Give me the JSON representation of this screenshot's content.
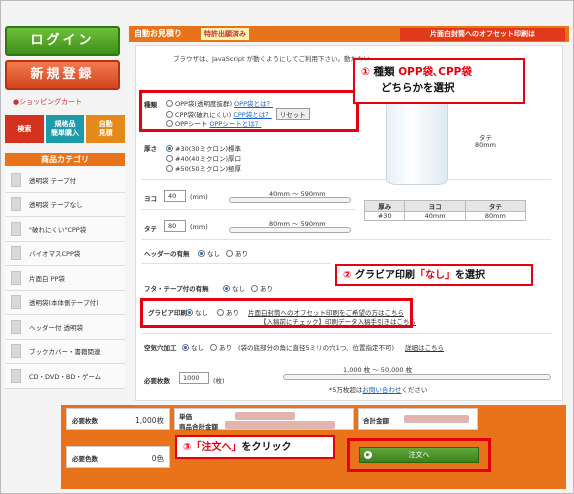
{
  "sidebar": {
    "login": "ログイン",
    "register": "新規登録",
    "cart": "ショッピングカート",
    "quick": [
      {
        "label": "検索"
      },
      {
        "label": "規格品\n簡単購入"
      },
      {
        "label": "自動\n見積"
      }
    ],
    "category_title": "商品カテゴリ",
    "categories": [
      {
        "label": "透明袋 テープ付"
      },
      {
        "label": "透明袋 テープなし"
      },
      {
        "label": "\"破れにくい\"CPP袋"
      },
      {
        "label": "バイオマスCPP袋"
      },
      {
        "label": "片面白 PP袋"
      },
      {
        "label": "透明袋(本体側テープ付)"
      },
      {
        "label": "ヘッダー付 透明袋"
      },
      {
        "label": "ブックカバー・書籍関連"
      },
      {
        "label": "CD・DVD・BD・ゲーム"
      }
    ]
  },
  "header": {
    "tab_title": "自動お見積り",
    "badge": "特許出願済み",
    "right_banner": "片面白封筒へのオフセット印刷は"
  },
  "form": {
    "notice": "ブラウザは、JavaScript が動くようにしてご利用下さい。動かない",
    "type_label": "種類",
    "type_options": [
      {
        "text": "OPP袋(透明度抜群)",
        "link": "OPP袋とは？"
      },
      {
        "text": "CPP袋(破れにくい)",
        "link": "CPP袋とは？"
      },
      {
        "text": "OPPシート",
        "link": "OPPシートとは？"
      }
    ],
    "reset": "リセット",
    "thickness_label": "厚さ",
    "thickness_options": [
      {
        "text": "#30(30ミクロン)標準"
      },
      {
        "text": "#40(40ミクロン)厚口"
      },
      {
        "text": "#50(50ミクロン)極厚"
      }
    ],
    "width_label": "ヨコ",
    "width_value": "40",
    "width_unit": "(mm)",
    "width_range": "40mm 〜 590mm",
    "height_label": "タテ",
    "height_value": "80",
    "height_unit": "(mm)",
    "height_range": "80mm 〜 590mm",
    "header_label": "ヘッダーの有無",
    "flap_label": "フタ・テープ付の有無",
    "yes": "あり",
    "no": "なし",
    "gravure_label": "グラビア印刷",
    "gravure_link1": "片面白封筒へのオフセット印刷をご希望の方はこちら",
    "gravure_link2": "【入稿前にチェック】印刷データ入稿手引きはこちら",
    "air_label": "空気穴加工",
    "air_note": "(袋の底部分の角に直径5ミリの穴1つ、位置指定不可)",
    "air_link": "詳細はこちら",
    "qty_label": "必要枚数",
    "qty_value": "1000",
    "qty_unit": "(枚)",
    "qty_range": "1,000 枚 〜 50,000 枚",
    "qty_note": "*5万枚超は",
    "qty_link": "お問い合わせ",
    "qty_note2": "ください"
  },
  "preview": {
    "side_label": "タテ",
    "side_value": "80mm",
    "table_headers": [
      "厚み",
      "ヨコ",
      "タテ"
    ],
    "table_row": [
      "#30",
      "40mm",
      "80mm"
    ]
  },
  "summary": {
    "qty_label": "必要枚数",
    "qty_value": "1,000枚",
    "unit_label": "単価",
    "subtotal_label": "商品合計金額",
    "total_label": "合計金額",
    "colors_label": "必要色数",
    "colors_value": "0色",
    "order_button": "注文へ"
  },
  "callouts": {
    "c1_num": "①",
    "c1_text1": "種類",
    "c1_text2": "OPP袋､CPP袋",
    "c1_text3": "どちらかを選択",
    "c2_num": "②",
    "c2_text1": "グラビア印刷",
    "c2_em": "「なし」",
    "c2_text2": "を選択",
    "c3_num": "③",
    "c3_em": "「注文へ」",
    "c3_text": "をクリック"
  }
}
